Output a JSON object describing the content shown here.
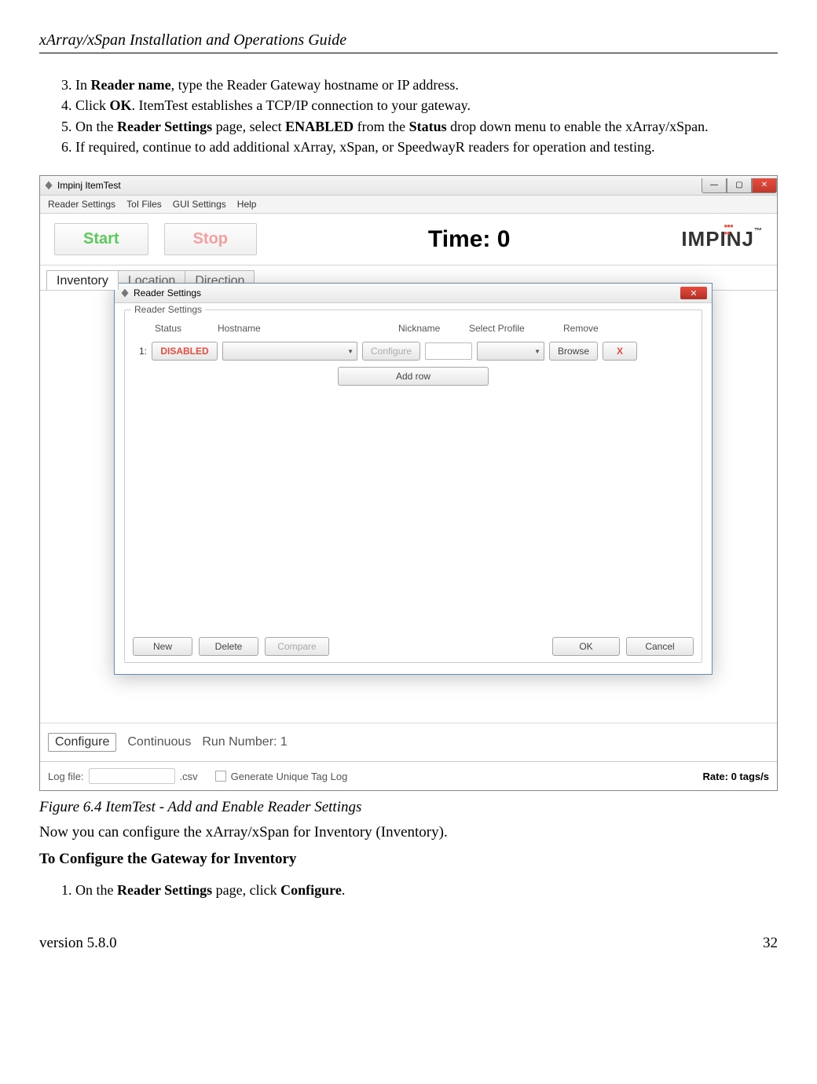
{
  "header": {
    "title": "xArray/xSpan Installation and Operations Guide"
  },
  "steps": {
    "s3_a": "In ",
    "s3_b": "Reader name",
    "s3_c": ", type the Reader Gateway hostname or IP address.",
    "s4_a": "Click ",
    "s4_b": "OK",
    "s4_c": ". ItemTest establishes a TCP/IP connection to your gateway.",
    "s5_a": "On the ",
    "s5_b": "Reader Settings",
    "s5_c": " page, select ",
    "s5_d": "ENABLED",
    "s5_e": " from the ",
    "s5_f": "Status",
    "s5_g": " drop down menu to enable the xArray/xSpan.",
    "s6": "If required, continue to add additional xArray, xSpan, or SpeedwayR readers for operation and testing."
  },
  "app": {
    "title": "Impinj ItemTest",
    "menu": {
      "m1": "Reader Settings",
      "m2": "ToI Files",
      "m3": "GUI Settings",
      "m4": "Help"
    },
    "start": "Start",
    "stop": "Stop",
    "time": "Time: 0",
    "logo": "IMPINJ",
    "logo_tm": "™",
    "tabs": {
      "t1": "Inventory",
      "t2": "Location",
      "t3": "Direction"
    },
    "dialog": {
      "title": "Reader Settings",
      "legend": "Reader Settings",
      "cols": {
        "status": "Status",
        "hostname": "Hostname",
        "nickname": "Nickname",
        "profile": "Select Profile",
        "remove": "Remove"
      },
      "row": {
        "idx": "1:",
        "status": "DISABLED",
        "configure": "Configure",
        "browse": "Browse",
        "remove": "X"
      },
      "addrow": "Add row",
      "btns": {
        "new": "New",
        "delete": "Delete",
        "compare": "Compare",
        "ok": "OK",
        "cancel": "Cancel"
      }
    },
    "bottom": {
      "configure": "Configure",
      "continuous": "Continuous",
      "run": "Run Number: 1"
    },
    "status": {
      "logfile": "Log file:",
      "ext": ".csv",
      "gen": "Generate Unique Tag Log",
      "rate": "Rate: 0 tags/s"
    }
  },
  "figcap": "Figure 6.4 ItemTest - Add and Enable Reader Settings",
  "para": "Now you can configure the xArray/xSpan for Inventory (Inventory).",
  "subhead": "To Configure the Gateway for Inventory",
  "steps2": {
    "s1_a": "On the ",
    "s1_b": "Reader Settings",
    "s1_c": " page, click ",
    "s1_d": "Configure",
    "s1_e": "."
  },
  "footer": {
    "version": "version 5.8.0",
    "page": "32"
  }
}
